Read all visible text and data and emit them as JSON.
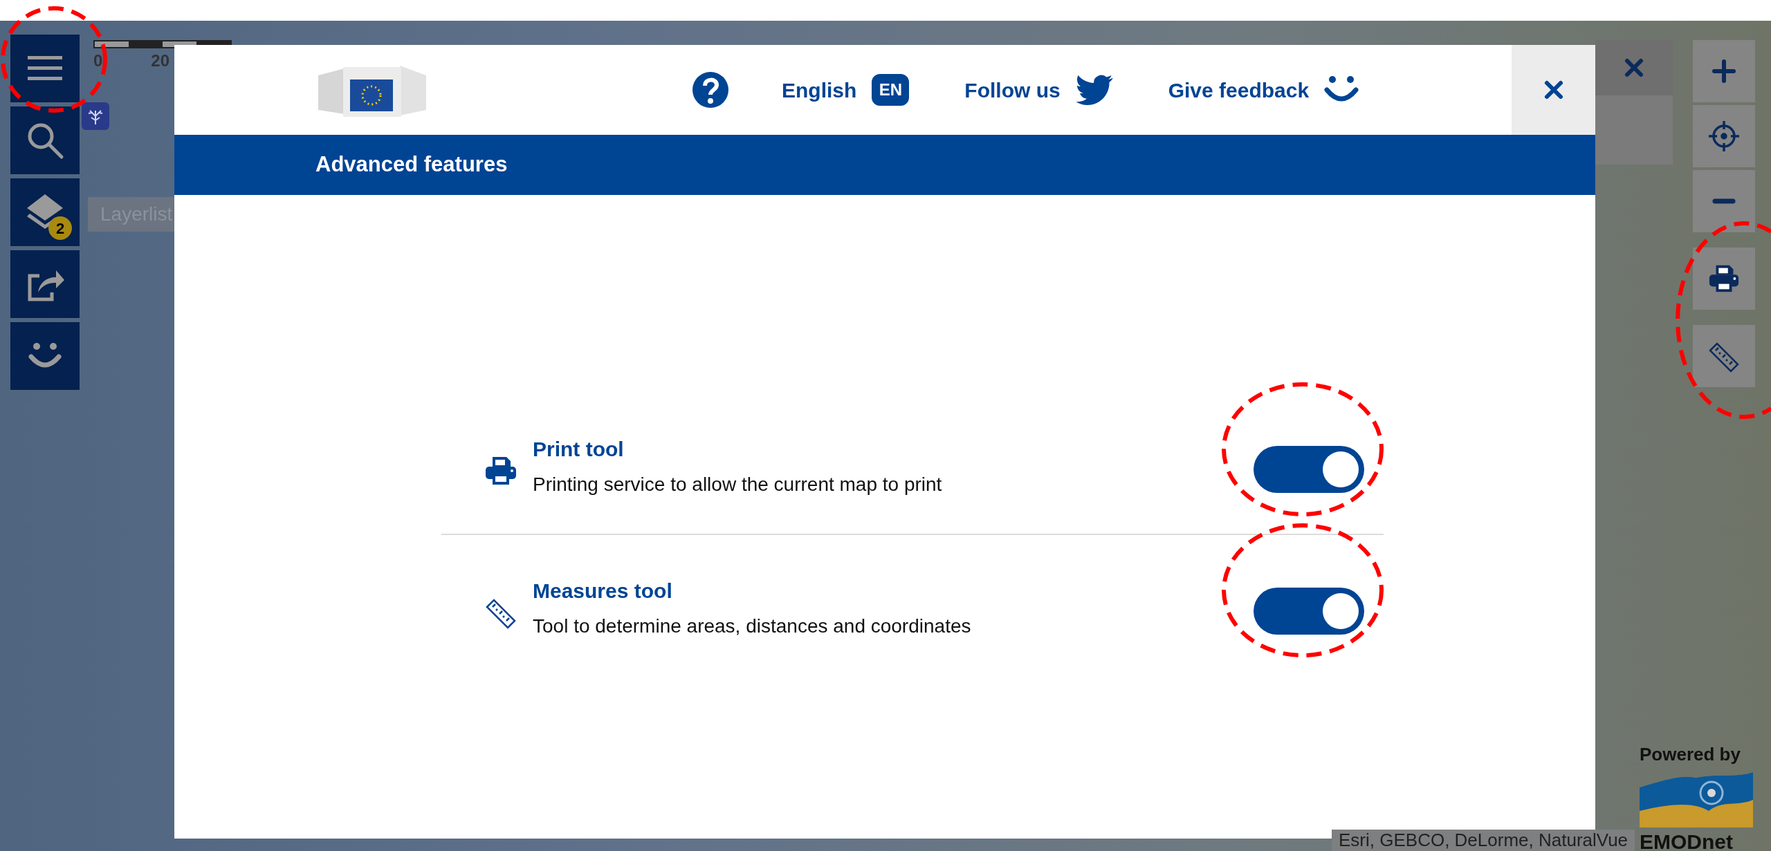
{
  "map": {
    "scale_labels": [
      "0",
      "20"
    ],
    "layer_list_label": "Layerlist",
    "attribution": "Esri, GEBCO, DeLorme, NaturalVue",
    "powered_by": "Powered by",
    "brand": "EMODnet"
  },
  "sidebar": {
    "layers_badge": "2"
  },
  "dialog": {
    "header_links": [
      {
        "kind": "help"
      },
      {
        "kind": "language",
        "label": "English",
        "badge": "EN"
      },
      {
        "kind": "follow",
        "label": "Follow us"
      },
      {
        "kind": "feedback",
        "label": "Give feedback"
      }
    ],
    "title": "Advanced features",
    "features": [
      {
        "kind": "print",
        "title": "Print tool",
        "description": "Printing service to allow the current map to print",
        "on": true
      },
      {
        "kind": "measure",
        "title": "Measures tool",
        "description": "Tool to determine areas, distances and coordinates",
        "on": true
      }
    ]
  }
}
